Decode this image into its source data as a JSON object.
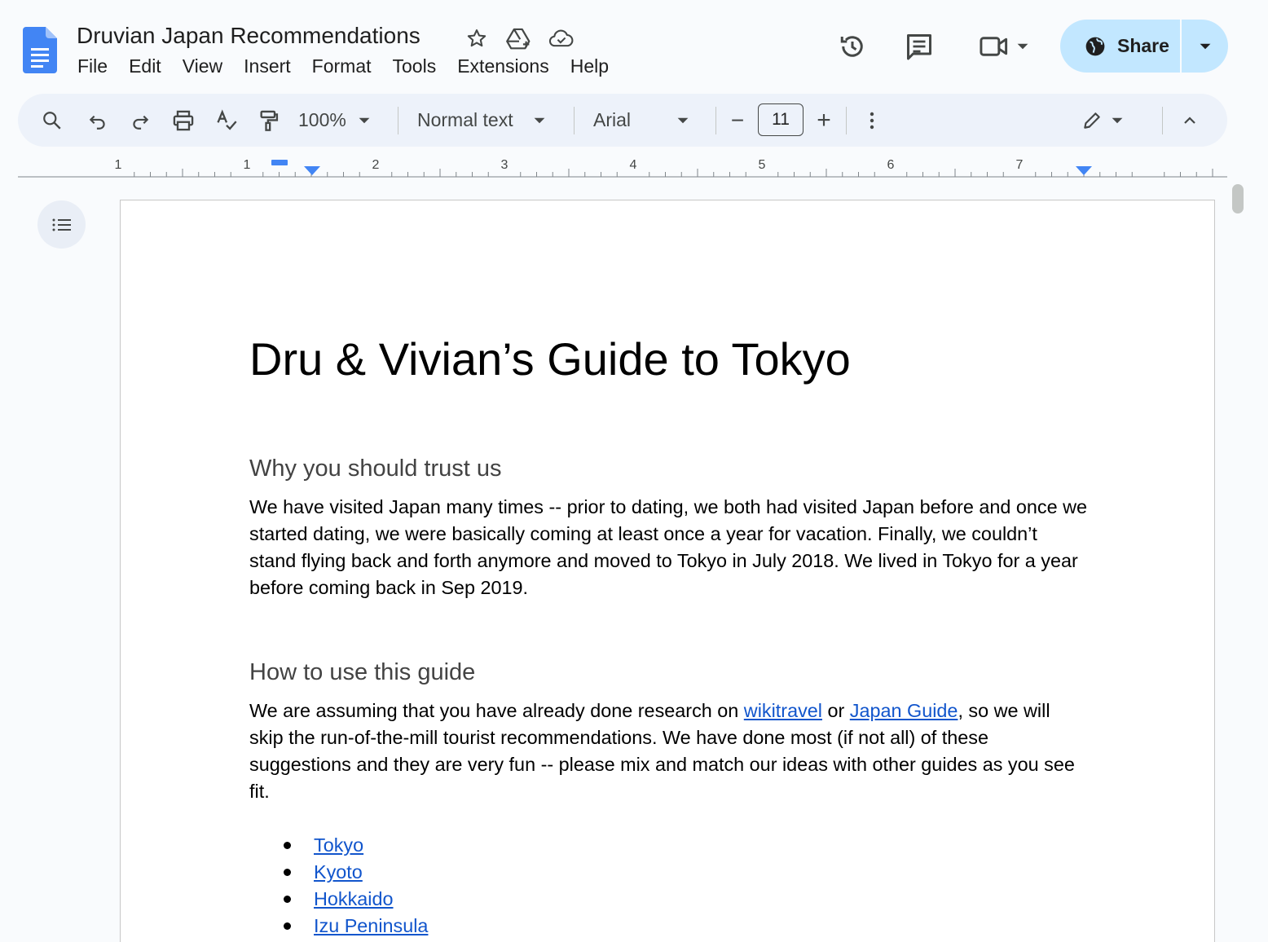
{
  "app": {
    "doc_title": "Druvian Japan Recommendations",
    "menu": [
      "File",
      "Edit",
      "View",
      "Insert",
      "Format",
      "Tools",
      "Extensions",
      "Help"
    ],
    "share_label": "Share",
    "accent_color": "#c2e7ff",
    "icons": [
      "docs-logo-icon",
      "star-icon",
      "move-to-drive-icon",
      "cloud-saved-icon",
      "version-history-icon",
      "comments-icon",
      "meet-camera-icon",
      "globe-icon",
      "search-icon",
      "undo-icon",
      "redo-icon",
      "print-icon",
      "spellcheck-icon",
      "paint-format-icon",
      "more-vert-icon",
      "pencil-icon",
      "collapse-chevron-icon",
      "outline-list-icon"
    ]
  },
  "toolbar": {
    "zoom": "100%",
    "style": "Normal text",
    "font": "Arial",
    "font_size": "11",
    "minus": "−",
    "plus": "+"
  },
  "ruler": {
    "labels": [
      "1",
      "1",
      "2",
      "3",
      "4",
      "5",
      "6",
      "7"
    ]
  },
  "document": {
    "title": "Dru & Vivian’s Guide to Tokyo",
    "section1": {
      "heading": "Why you should trust us",
      "body": "We have visited Japan many times -- prior to dating, we both had visited Japan before and once we started dating, we were basically coming at least once a year for vacation. Finally, we couldn’t stand flying back and forth anymore and moved to Tokyo in July 2018. We lived in Tokyo for a year before coming back in Sep 2019."
    },
    "section2": {
      "heading": "How to use this guide",
      "body_part1": "We are assuming that you have already done research on ",
      "link1": "wikitravel",
      "body_part2": " or ",
      "link2": "Japan Guide",
      "body_part3": ", so we will skip the run-of-the-mill tourist recommendations. We have done most (if not all) of these suggestions and they are very fun -- please mix and match our ideas with other guides as you see fit."
    },
    "list": [
      "Tokyo",
      "Kyoto",
      "Hokkaido",
      "Izu Peninsula"
    ]
  }
}
